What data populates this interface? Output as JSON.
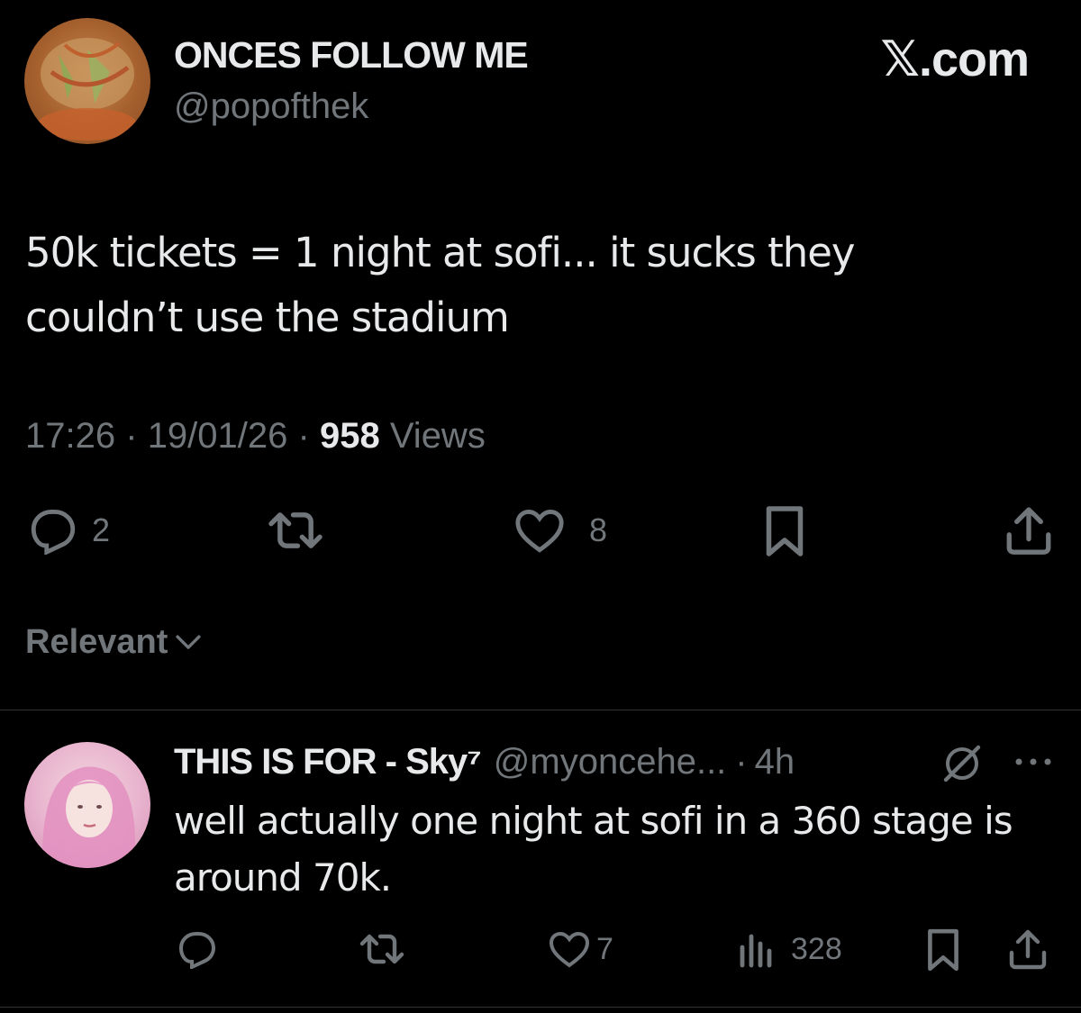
{
  "watermark": "𝕏.com",
  "tweet": {
    "display_name": "ONCES FOLLOW ME",
    "handle": "@popofthek",
    "text_line1": "50k tickets = 1 night at sofi... it sucks they",
    "text_line2": "couldn’t use the stadium",
    "time": "17:26",
    "date": "19/01/26",
    "views_count": "958",
    "views_label": "Views",
    "separator": "·",
    "replies": "2",
    "likes": "8"
  },
  "sort": {
    "label": "Relevant"
  },
  "reply": {
    "display_name": "THIS IS FOR - Sky⁷",
    "handle": "@myoncehe...",
    "separator": "·",
    "time": "4h",
    "text_line1": "well actually one night at sofi in a 360 stage is",
    "text_line2": "around 70k.",
    "likes": "7",
    "views": "328"
  },
  "colors": {
    "background": "#000000",
    "text": "#e7e9ea",
    "secondary": "#71767b",
    "divider": "#2f3336"
  }
}
